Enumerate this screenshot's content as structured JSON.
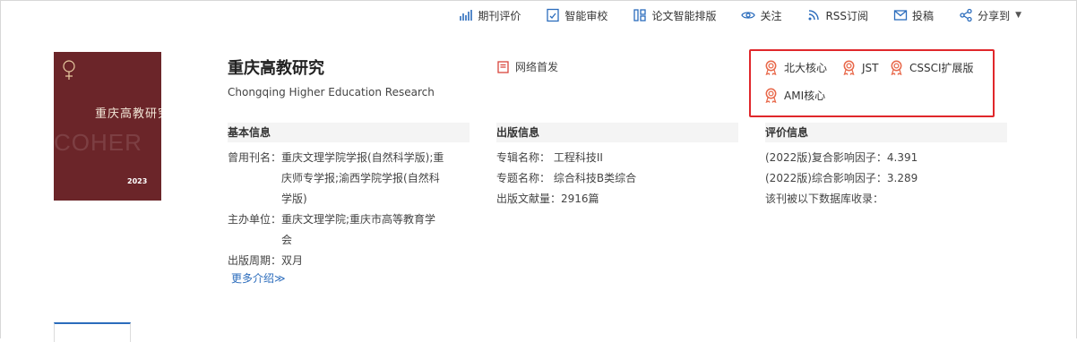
{
  "toolbar": {
    "items": [
      {
        "label": "期刊评价",
        "icon": "bar-chart-icon"
      },
      {
        "label": "智能审校",
        "icon": "document-check-icon"
      },
      {
        "label": "论文智能排版",
        "icon": "layout-icon"
      },
      {
        "label": "关注",
        "icon": "eye-icon"
      },
      {
        "label": "RSS订阅",
        "icon": "rss-icon"
      },
      {
        "label": "投稿",
        "icon": "mail-icon"
      },
      {
        "label": "分享到",
        "icon": "share-icon"
      }
    ]
  },
  "journal": {
    "title": "重庆高教研究",
    "title_en": "Chongqing Higher Education Research",
    "network_first": "网络首发",
    "cover": {
      "title": "重庆高教研究",
      "en": "COHER",
      "year": "2023"
    }
  },
  "badges": [
    "北大核心",
    "JST",
    "CSSCI扩展版",
    "AMI核心"
  ],
  "basic": {
    "heading": "基本信息",
    "former_label": "曾用刊名：",
    "former_lines": [
      "重庆文理学院学报(自然科学版);重",
      "庆师专学报;渝西学院学报(自然科",
      "学版)"
    ],
    "sponsor_label": "主办单位：",
    "sponsor_lines": [
      "重庆文理学院;重庆市高等教育学",
      "会"
    ],
    "period_label": "出版周期：",
    "period_value": "双月",
    "more": "更多介绍≫"
  },
  "publish": {
    "heading": "出版信息",
    "items": [
      {
        "label": "专辑名称：",
        "value": "工程科技II"
      },
      {
        "label": "专题名称：",
        "value": "综合科技B类综合"
      },
      {
        "label": "出版文献量：",
        "value": "2916篇"
      }
    ]
  },
  "evaluation": {
    "heading": "评价信息",
    "items": [
      "(2022版)复合影响因子：4.391",
      "(2022版)综合影响因子：3.289",
      "该刊被以下数据库收录："
    ]
  },
  "colors": {
    "accent": "#2b6cbc",
    "highlight_border": "#e0272b",
    "badge": "#e8684a",
    "cover": "#6b2529"
  }
}
